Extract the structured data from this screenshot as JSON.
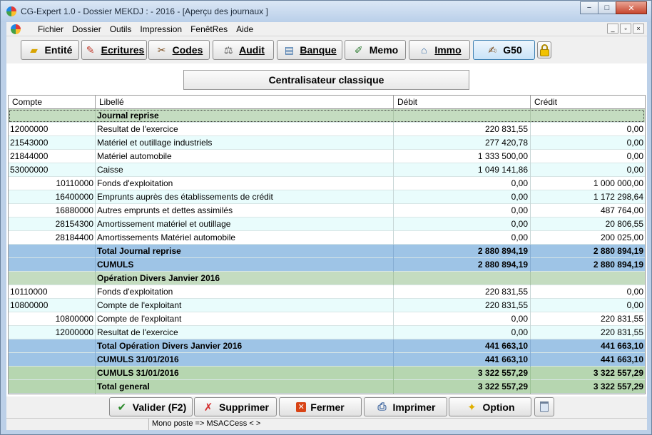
{
  "window": {
    "title": "CG-Expert 1.0 - Dossier MEKDJ :  - 2016 - [Aperçu des journaux ]",
    "minimize": "−",
    "maximize": "□",
    "close": "✕"
  },
  "menubar": {
    "items": [
      "Fichier",
      "Dossier",
      "Outils",
      "Impression",
      "FenêtRes",
      "Aide"
    ],
    "mdi": [
      "_",
      "▫",
      "×"
    ]
  },
  "toolbar": {
    "buttons": [
      {
        "label": "Entité",
        "icon": "folder-icon"
      },
      {
        "label": "Ecritures",
        "icon": "pencil-icon"
      },
      {
        "label": "Codes",
        "icon": "tools-icon"
      },
      {
        "label": "Audit",
        "icon": "balance-icon"
      },
      {
        "label": "Banque",
        "icon": "document-icon"
      },
      {
        "label": "Memo",
        "icon": "notepad-icon"
      },
      {
        "label": "Immo",
        "icon": "house-icon"
      },
      {
        "label": "G50",
        "icon": "edit-icon"
      }
    ]
  },
  "header_button": "Centralisateur classique",
  "table": {
    "columns": [
      "Compte",
      "Libellé",
      "Débit",
      "Crédit"
    ],
    "rows": [
      {
        "type": "section",
        "compte": "",
        "libelle": "Journal reprise",
        "debit": "",
        "credit": ""
      },
      {
        "type": "white",
        "compte": "12000000",
        "libelle": "Resultat de l'exercice",
        "debit": "220 831,55",
        "credit": "0,00"
      },
      {
        "type": "cyan",
        "compte": "21543000",
        "libelle": "Matériel et outillage industriels",
        "debit": "277 420,78",
        "credit": "0,00"
      },
      {
        "type": "white",
        "compte": "21844000",
        "libelle": "Matériel automobile",
        "debit": "1 333 500,00",
        "credit": "0,00"
      },
      {
        "type": "cyan",
        "compte": "53000000",
        "libelle": "Caisse",
        "debit": "1 049 141,86",
        "credit": "0,00"
      },
      {
        "type": "white",
        "indent": true,
        "compte": "10110000",
        "libelle": "Fonds d'exploitation",
        "debit": "0,00",
        "credit": "1 000 000,00"
      },
      {
        "type": "cyan",
        "indent": true,
        "compte": "16400000",
        "libelle": "Emprunts auprès des établissements de crédit",
        "debit": "0,00",
        "credit": "1 172 298,64"
      },
      {
        "type": "white",
        "indent": true,
        "compte": "16880000",
        "libelle": "Autres emprunts et dettes assimilés",
        "debit": "0,00",
        "credit": "487 764,00"
      },
      {
        "type": "cyan",
        "indent": true,
        "compte": "28154300",
        "libelle": "Amortissement matériel et outillage",
        "debit": "0,00",
        "credit": "20 806,55"
      },
      {
        "type": "white",
        "indent": true,
        "compte": "28184400",
        "libelle": "Amortissements Matériel automobile",
        "debit": "0,00",
        "credit": "200 025,00"
      },
      {
        "type": "total",
        "compte": "",
        "libelle": "Total  Journal reprise",
        "debit": "2 880 894,19",
        "credit": "2 880 894,19"
      },
      {
        "type": "total",
        "compte": "",
        "libelle": "CUMULS",
        "debit": "2 880 894,19",
        "credit": "2 880 894,19"
      },
      {
        "type": "section",
        "compte": "",
        "libelle": "Opération Divers    Janvier 2016",
        "debit": "",
        "credit": ""
      },
      {
        "type": "white",
        "compte": "10110000",
        "libelle": "Fonds d'exploitation",
        "debit": "220 831,55",
        "credit": "0,00"
      },
      {
        "type": "cyan",
        "compte": "10800000",
        "libelle": "Compte de l'exploitant",
        "debit": "220 831,55",
        "credit": "0,00"
      },
      {
        "type": "white",
        "indent": true,
        "compte": "10800000",
        "libelle": "Compte de l'exploitant",
        "debit": "0,00",
        "credit": "220 831,55"
      },
      {
        "type": "cyan",
        "indent": true,
        "compte": "12000000",
        "libelle": "Resultat de l'exercice",
        "debit": "0,00",
        "credit": "220 831,55"
      },
      {
        "type": "total",
        "compte": "",
        "libelle": "Total  Opération Divers  Janvier 2016",
        "debit": "441 663,10",
        "credit": "441 663,10"
      },
      {
        "type": "total",
        "compte": "",
        "libelle": "CUMULS 31/01/2016",
        "debit": "441 663,10",
        "credit": "441 663,10"
      },
      {
        "type": "grand",
        "compte": "",
        "libelle": "CUMULS 31/01/2016",
        "debit": "3 322 557,29",
        "credit": "3 322 557,29"
      },
      {
        "type": "grand",
        "compte": "",
        "libelle": "Total general",
        "debit": "3 322 557,29",
        "credit": "3 322 557,29"
      }
    ]
  },
  "bottom": {
    "valider": "Valider (F2)",
    "supprimer": "Supprimer",
    "fermer": "Fermer",
    "imprimer": "Imprimer",
    "option": "Option"
  },
  "status": {
    "text": "Mono poste => MSACCess <  >"
  },
  "colors": {
    "section": "#c4dcc0",
    "total": "#9ec4e6",
    "grand": "#b6d6b0",
    "row_alt": "#e9fcfc"
  }
}
